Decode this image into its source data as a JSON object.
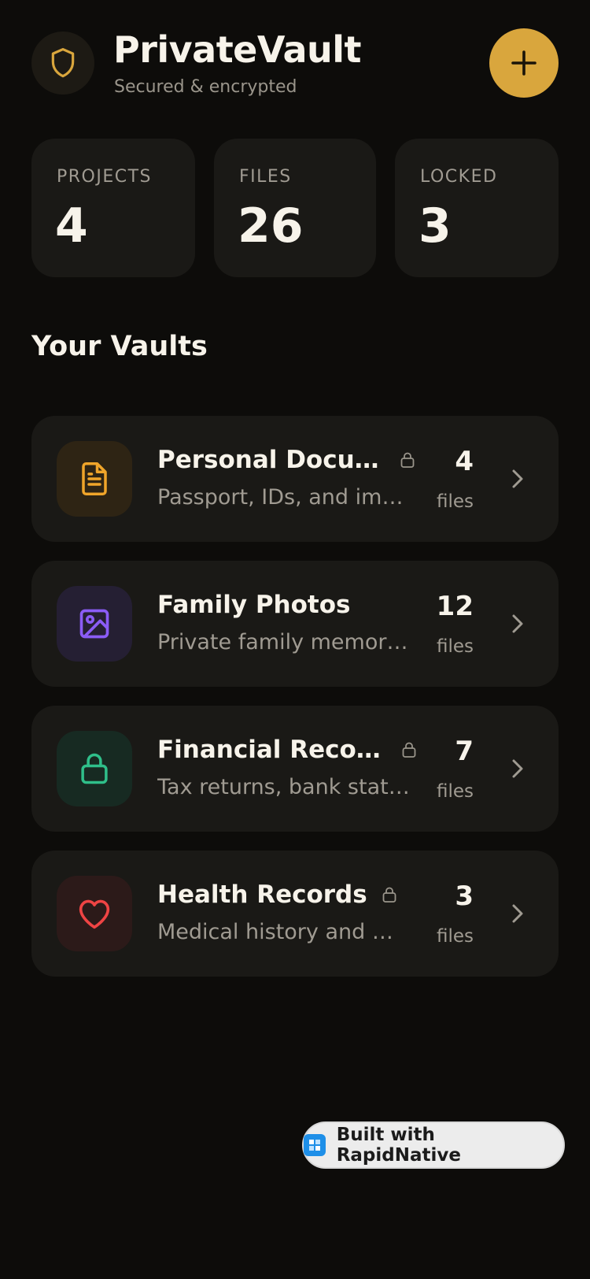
{
  "app": {
    "title": "PrivateVault",
    "subtitle": "Secured & encrypted",
    "logo_icon": "shield-icon",
    "add_icon": "plus-icon",
    "accent": "#d9a63d"
  },
  "stats": [
    {
      "label": "PROJECTS",
      "value": "4"
    },
    {
      "label": "FILES",
      "value": "26"
    },
    {
      "label": "LOCKED",
      "value": "3"
    }
  ],
  "section": {
    "title": "Your Vaults"
  },
  "vaults": [
    {
      "name": "Personal Documents",
      "description": "Passport, IDs, and important papers",
      "count": "4",
      "unit": "files",
      "locked": true,
      "icon": "document-icon",
      "icon_color": "#f0a52a",
      "icon_bg": "#2e2414"
    },
    {
      "name": "Family Photos",
      "description": "Private family memories",
      "count": "12",
      "unit": "files",
      "locked": false,
      "icon": "image-icon",
      "icon_color": "#8b5cf6",
      "icon_bg": "#251f33"
    },
    {
      "name": "Financial Records",
      "description": "Tax returns, bank statements",
      "count": "7",
      "unit": "files",
      "locked": true,
      "icon": "lock-icon",
      "icon_color": "#2fbf8a",
      "icon_bg": "#172a22"
    },
    {
      "name": "Health Records",
      "description": "Medical history and prescriptions",
      "count": "3",
      "unit": "files",
      "locked": true,
      "icon": "heart-icon",
      "icon_color": "#ef4444",
      "icon_bg": "#2c1a19"
    }
  ],
  "badge": {
    "label": "Built with RapidNative",
    "icon": "rapidnative-logo-icon"
  }
}
